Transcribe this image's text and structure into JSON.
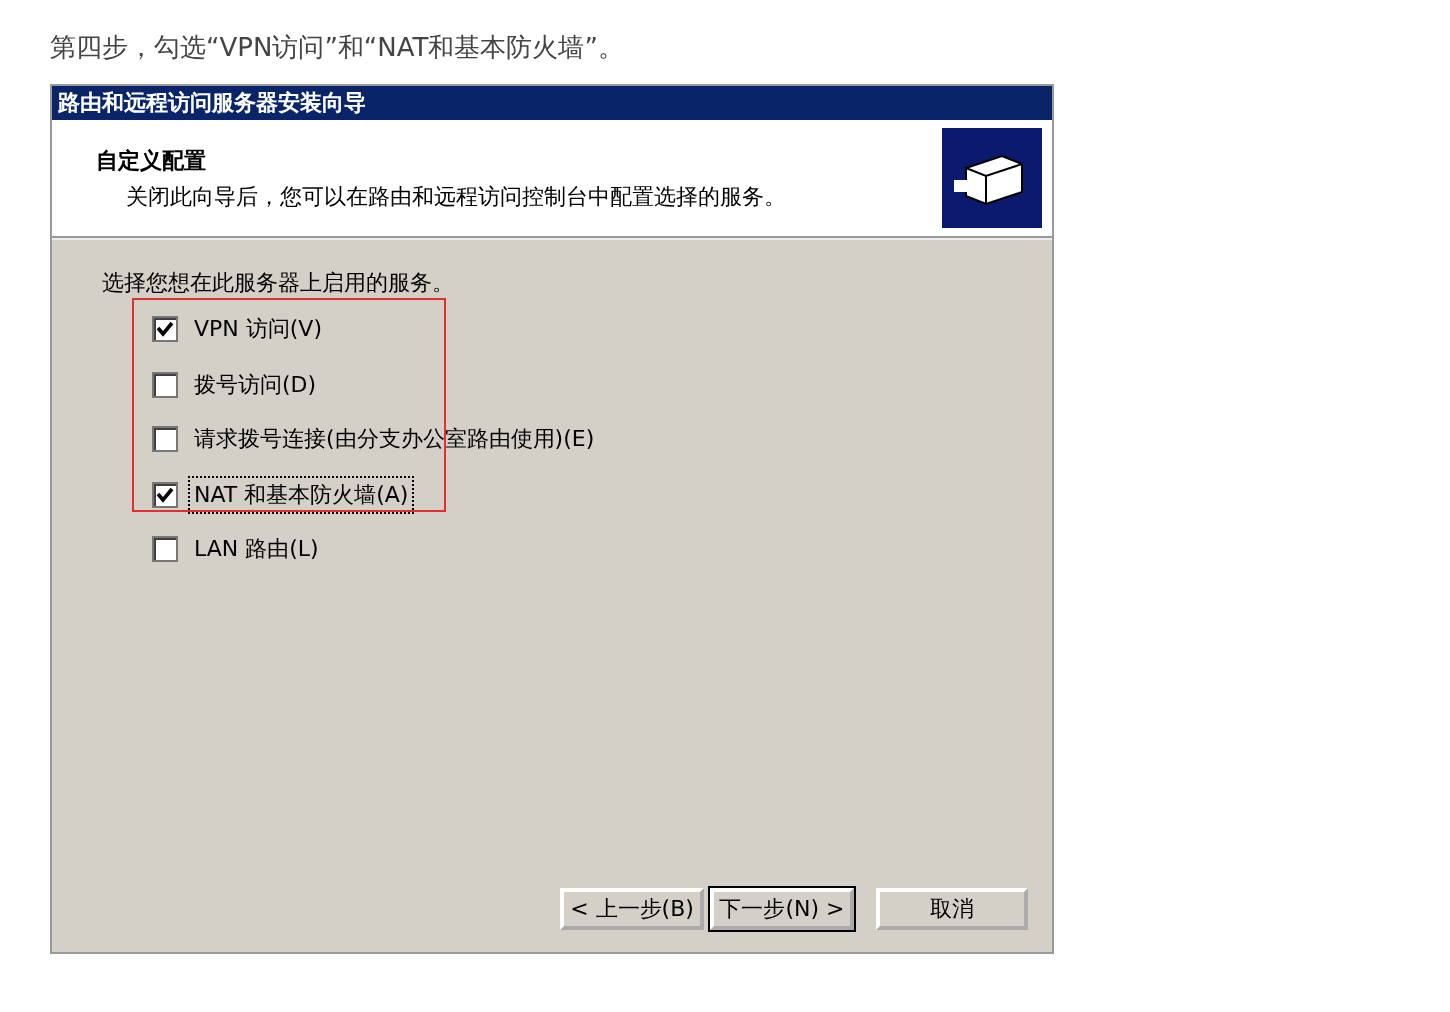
{
  "caption": "第四步，勾选“VPN访问”和“NAT和基本防火墙”。",
  "window": {
    "title": "路由和远程访问服务器安装向导"
  },
  "header": {
    "title": "自定义配置",
    "subtitle": "关闭此向导后，您可以在路由和远程访问控制台中配置选择的服务。"
  },
  "prompt": "选择您想在此服务器上启用的服务。",
  "options": [
    {
      "label": "VPN 访问(V)",
      "checked": true,
      "focused": false
    },
    {
      "label": "拨号访问(D)",
      "checked": false,
      "focused": false
    },
    {
      "label": "请求拨号连接(由分支办公室路由使用)(E)",
      "checked": false,
      "focused": false
    },
    {
      "label": "NAT 和基本防火墙(A)",
      "checked": true,
      "focused": true
    },
    {
      "label": "LAN 路由(L)",
      "checked": false,
      "focused": false
    }
  ],
  "buttons": [
    {
      "label": "< 上一步(B)",
      "default": false
    },
    {
      "label": "下一步(N) >",
      "default": true
    },
    {
      "label": "取消",
      "default": false
    }
  ]
}
